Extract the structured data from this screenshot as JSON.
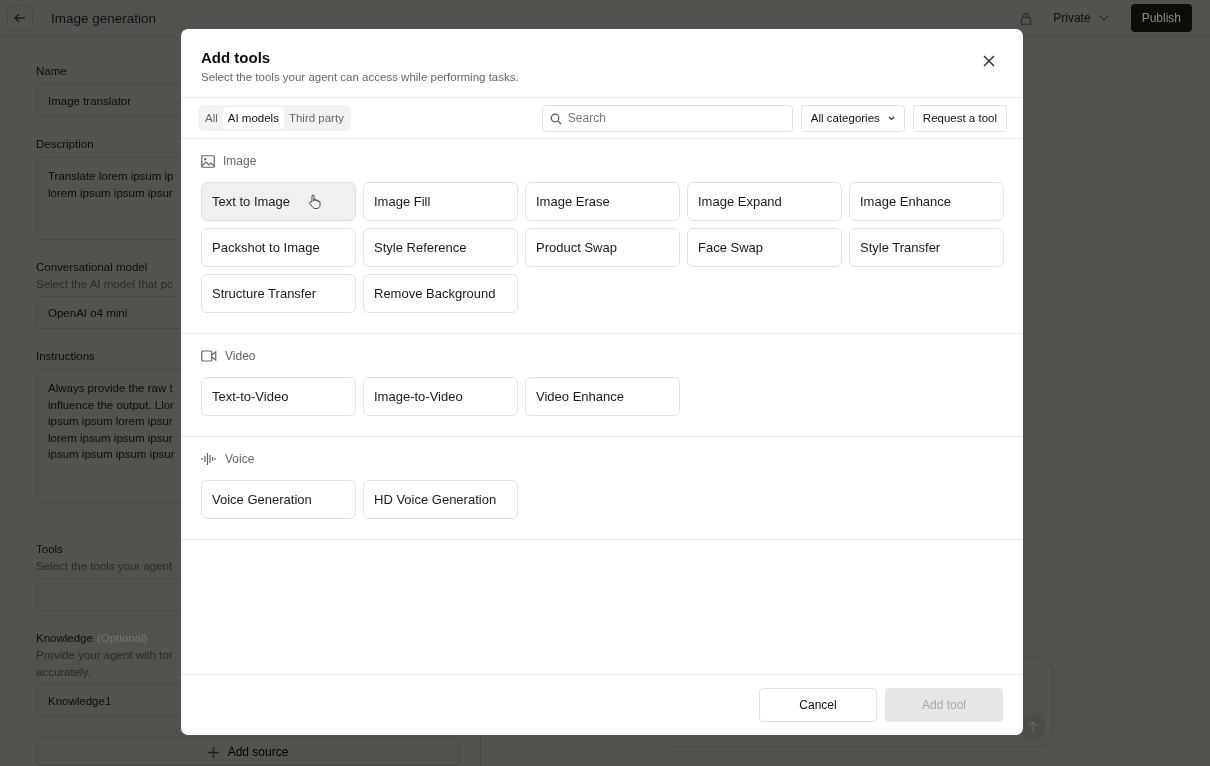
{
  "page": {
    "title": "Image generation",
    "visibility": "Private",
    "publish": "Publish"
  },
  "form": {
    "fields": [
      {
        "kind": "input",
        "label": "Name",
        "lines": [
          "Image translator"
        ]
      },
      {
        "kind": "textarea",
        "label": "Description",
        "lines": [
          "Translate lorem ipsum ip",
          "lorem ipsum ipsum ipsur"
        ]
      },
      {
        "kind": "input",
        "label": "Conversational model",
        "hint": [
          "Select the AI model that pc"
        ],
        "lines": [
          "OpenAI o4 mini"
        ]
      },
      {
        "kind": "textarea",
        "label": "Instructions",
        "lines": [
          "Always provide the raw t",
          "influence the output. Llor",
          "ipsum ipsum lorem ipsur",
          "lorem ipsum ipsum ipsur",
          "ipsum ipsum ipsum ipsur"
        ]
      },
      {
        "kind": "input",
        "label": "Tools",
        "hint": [
          "Select the tools your agent"
        ]
      },
      {
        "kind": "input",
        "label": "Knowledge",
        "optional": "(Optional)",
        "hint": [
          "Provide your agent with tor",
          "accurately."
        ],
        "lines": [
          "Knowledge1"
        ]
      }
    ],
    "add_source": "Add source"
  },
  "dialog": {
    "title": "Add tools",
    "subtitle": "Select the tools your agent can access while performing tasks.",
    "tabs": [
      {
        "label": "All",
        "selected": false
      },
      {
        "label": "AI models",
        "selected": true
      },
      {
        "label": "Third party",
        "selected": false
      }
    ],
    "search": {
      "placeholder": "Search"
    },
    "category": "All categories",
    "request": "Request a tool",
    "sections": [
      {
        "kind": "image",
        "title": "Image",
        "tools": [
          {
            "label": "Text to Image",
            "hovered": true
          },
          {
            "label": "Image Fill",
            "hovered": false
          },
          {
            "label": "Image Erase",
            "hovered": false
          },
          {
            "label": "Image Expand",
            "hovered": false
          },
          {
            "label": "Image Enhance",
            "hovered": false
          },
          {
            "label": "Packshot to Image",
            "hovered": false
          },
          {
            "label": "Style Reference",
            "hovered": false
          },
          {
            "label": "Product Swap",
            "hovered": false
          },
          {
            "label": "Face Swap",
            "hovered": false
          },
          {
            "label": "Style Transfer",
            "hovered": false
          },
          {
            "label": "Structure Transfer",
            "hovered": false
          },
          {
            "label": "Remove Background",
            "hovered": false
          }
        ]
      },
      {
        "kind": "video",
        "title": "Video",
        "tools": [
          {
            "label": "Text-to-Video",
            "hovered": false
          },
          {
            "label": "Image-to-Video",
            "hovered": false
          },
          {
            "label": "Video Enhance",
            "hovered": false
          }
        ]
      },
      {
        "kind": "voice",
        "title": "Voice",
        "tools": [
          {
            "label": "Voice Generation",
            "hovered": false
          },
          {
            "label": "HD Voice Generation",
            "hovered": false
          }
        ]
      }
    ],
    "cancel": "Cancel",
    "add": {
      "label": "Add tool",
      "disabled": true
    }
  }
}
